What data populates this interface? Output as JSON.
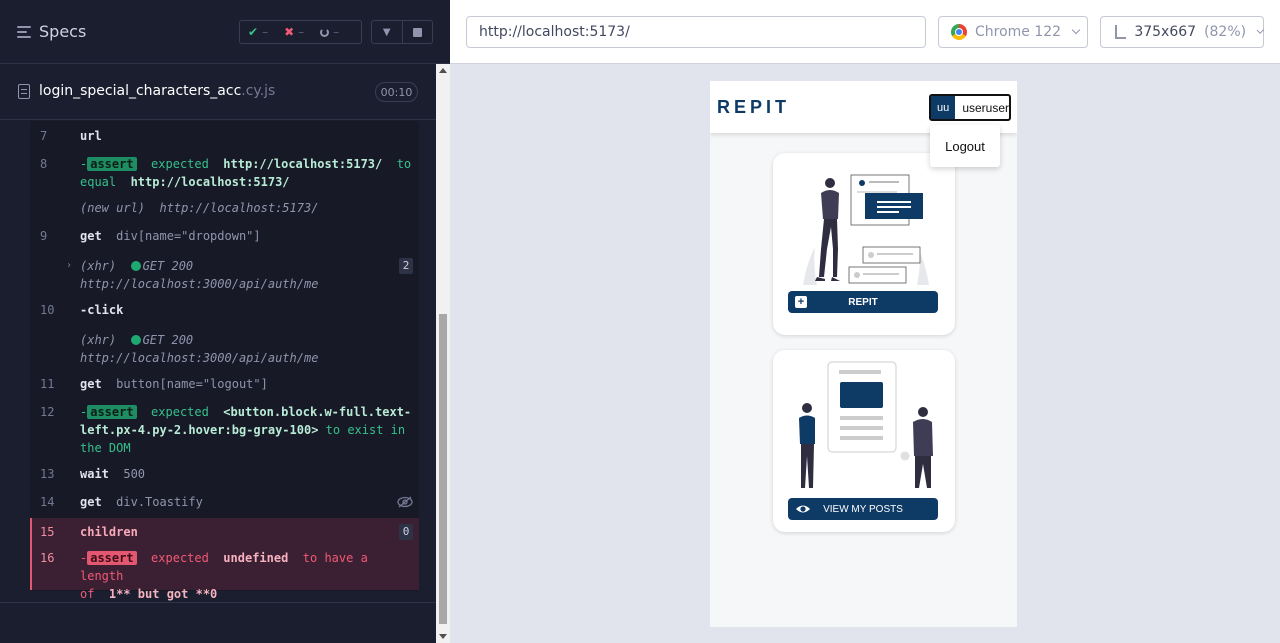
{
  "runner": {
    "specs_title": "Specs",
    "stats": {
      "passed": "–",
      "failed": "–",
      "pending": "–"
    },
    "spec_name": "login_special_characters_acc",
    "spec_ext": ".cy.js",
    "duration": "00:10"
  },
  "commands": {
    "c7": {
      "num": "7",
      "name": "url"
    },
    "c8": {
      "num": "8",
      "dash": "-",
      "badge": "assert",
      "w1": "expected",
      "v1": "http://localhost:5173/",
      "w2": "to",
      "w3": "equal",
      "v2": "http://localhost:5173/"
    },
    "c8b": {
      "label": "(new url)",
      "value": "http://localhost:5173/"
    },
    "c9": {
      "num": "9",
      "name": "get",
      "sel": "div[name=\"dropdown\"]"
    },
    "c9x": {
      "label": "(xhr)",
      "req": "GET 200",
      "url": "http://localhost:3000/api/auth/me",
      "count": "2"
    },
    "c10": {
      "num": "10",
      "dash": "-",
      "name": "click"
    },
    "c10x": {
      "label": "(xhr)",
      "req": "GET 200",
      "url": "http://localhost:3000/api/auth/me"
    },
    "c11": {
      "num": "11",
      "name": "get",
      "sel": "button[name=\"logout\"]"
    },
    "c12": {
      "num": "12",
      "dash": "-",
      "badge": "assert",
      "w1": "expected",
      "v1a": "<button.block.w-full.text-",
      "v1b": "left.px-4.py-2.hover:bg-gray-100>",
      "w2": "to exist in",
      "w3": "the DOM"
    },
    "c13": {
      "num": "13",
      "name": "wait",
      "sel": "500"
    },
    "c14": {
      "num": "14",
      "name": "get",
      "sel": "div.Toastify"
    },
    "c15": {
      "num": "15",
      "name": "children",
      "count": "0"
    },
    "c16": {
      "num": "16",
      "dash": "-",
      "badge": "assert",
      "w1": "expected",
      "v1": "undefined",
      "w2": "to have a length",
      "w3": "of",
      "v2": "1** but got **0"
    }
  },
  "browser": {
    "url": "http://localhost:5173/",
    "browser_name": "Chrome 122",
    "viewport": "375x667",
    "scale": "(82%)"
  },
  "app": {
    "logo": "REPIT",
    "avatar": "uu",
    "username": "useruser",
    "logout": "Logout",
    "card1_button": "REPIT",
    "card2_button": "VIEW MY POSTS",
    "brand_color": "#0e3a66"
  }
}
